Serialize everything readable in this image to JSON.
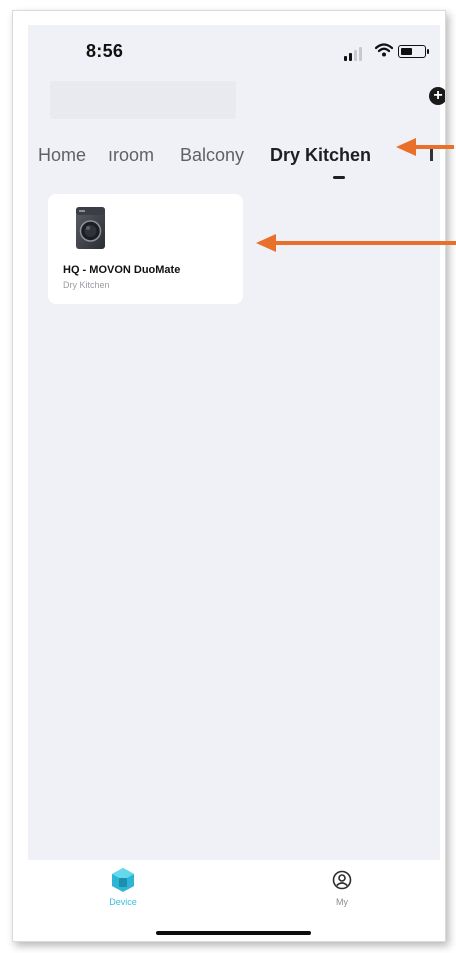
{
  "status_bar": {
    "time": "8:56"
  },
  "home_selector": {
    "name": ""
  },
  "header": {
    "add_icon": "plus-circle-icon",
    "add_glyph": "+"
  },
  "room_tabs": [
    {
      "label": "Home"
    },
    {
      "label": "ıroom"
    },
    {
      "label": "Balcony"
    },
    {
      "label": "Dry Kitchen",
      "active": true
    }
  ],
  "devices": [
    {
      "name": "HQ  - MOVON DuoMate",
      "room": "Dry Kitchen",
      "icon": "washing-machine-icon"
    }
  ],
  "bottom_nav": {
    "device_label": "Device",
    "my_label": "My"
  },
  "colors": {
    "background": "#f0f1f6",
    "card": "#ffffff",
    "accent": "#37c0da",
    "arrow": "#e8702a"
  }
}
